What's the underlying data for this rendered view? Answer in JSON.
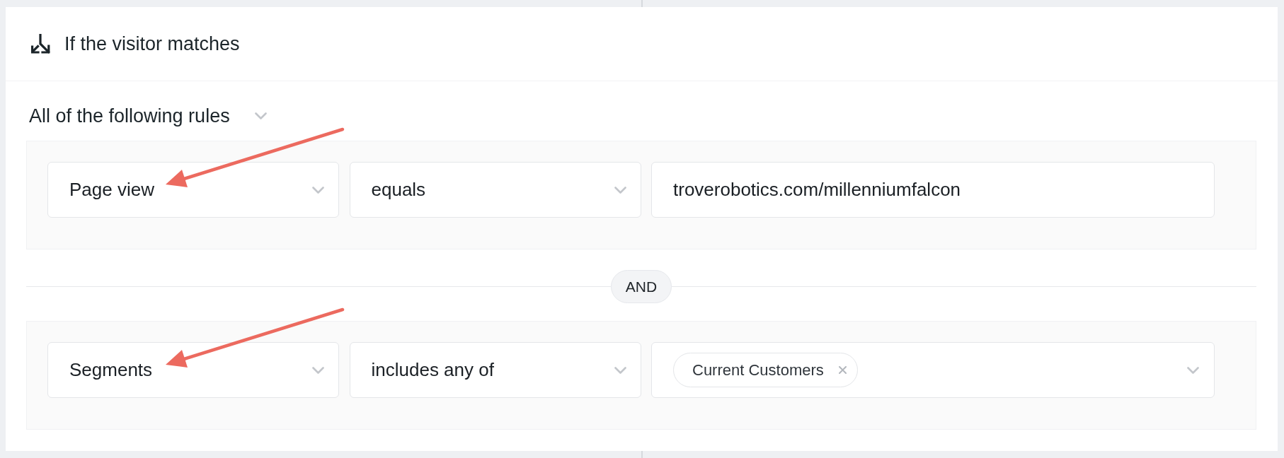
{
  "condition": {
    "title": "If the visitor matches",
    "match_mode": "All of the following rules"
  },
  "rules": [
    {
      "field": "Page view",
      "operator": "equals",
      "value": {
        "kind": "text",
        "text": "troverobotics.com/millenniumfalcon"
      },
      "annotated": true
    },
    {
      "joined_by": "AND",
      "field": "Segments",
      "operator": "includes any of",
      "value": {
        "kind": "tags",
        "tags": [
          {
            "label": "Current Customers"
          }
        ]
      },
      "annotated": true
    }
  ]
}
